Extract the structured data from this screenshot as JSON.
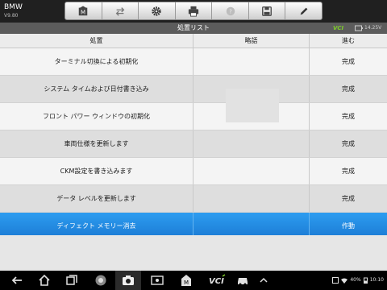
{
  "app": {
    "name": "BMW",
    "version": "V9.80"
  },
  "toolbar": {
    "buttons": [
      {
        "icon": "home-icon"
      },
      {
        "icon": "vehicle-swap-icon"
      },
      {
        "icon": "gear-icon"
      },
      {
        "icon": "printer-icon"
      },
      {
        "icon": "help-icon"
      },
      {
        "icon": "save-icon"
      },
      {
        "icon": "pencil-icon"
      }
    ]
  },
  "subbar": {
    "title": "処置リスト",
    "vci": "VCI",
    "voltage": "14.25V"
  },
  "table": {
    "headers": [
      "処置",
      "略語",
      "進む"
    ],
    "rows": [
      {
        "action": "ターミナル切換による初期化",
        "abbr": "",
        "status": "完成"
      },
      {
        "action": "システム タイムおよび日付書き込み",
        "abbr": "",
        "status": "完成"
      },
      {
        "action": "フロント パワー ウィンドウの初期化",
        "abbr": "",
        "status": "完成"
      },
      {
        "action": "車両仕様を更新します",
        "abbr": "",
        "status": "完成"
      },
      {
        "action": "CKM設定を書き込みます",
        "abbr": "",
        "status": "完成"
      },
      {
        "action": "データ レベルを更新します",
        "abbr": "",
        "status": "完成"
      },
      {
        "action": "ディフェクト メモリー消去",
        "abbr": "",
        "status": "作動"
      }
    ]
  },
  "statusbar": {
    "battery": "40%",
    "time": "10:10",
    "vci": "VCI"
  },
  "colors": {
    "selected_row": "#1e88e5",
    "vci_green": "#7ecb2a",
    "topbar": "#202020"
  }
}
